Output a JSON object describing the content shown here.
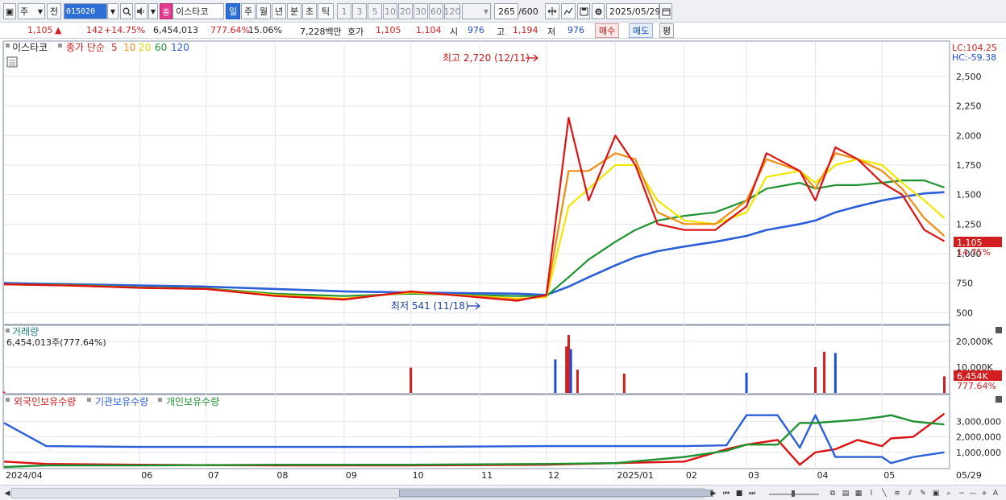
{
  "toolbar": {
    "market_label": "주",
    "prev_label": "전",
    "code": "015020",
    "name_badge": "종",
    "stock_name": "이스타코",
    "periods": [
      "일",
      "주",
      "월",
      "년",
      "분",
      "초",
      "틱"
    ],
    "selected_period": "일",
    "intervals": [
      "1",
      "3",
      "5",
      "10",
      "20",
      "30",
      "60",
      "120"
    ],
    "count_value": "265",
    "count_total": "/600",
    "date": "2025/05/29"
  },
  "quote": {
    "price": "1,105",
    "change": "142",
    "change_pct": "+14.75%",
    "volume": "6,454,013",
    "volume_ratio": "777.64%",
    "turnover": "15.06%",
    "amount": "7,228백만",
    "bidask_label": "호가",
    "ask": "1,105",
    "bid": "1,104",
    "open_label": "시",
    "open": "976",
    "high_label": "고",
    "high": "1,194",
    "low_label": "저",
    "low": "976",
    "buy_label": "매수",
    "sell_label": "매도",
    "eval_label": "평"
  },
  "price_panel": {
    "title": "이스타코",
    "ma_label": "종가 단순",
    "ma_periods": [
      "5",
      "10",
      "20",
      "60",
      "120"
    ],
    "lc_label": "LC:104.25",
    "hc_label": "HC:-59.38",
    "high_annotation": "최고 2,720 (12/11)",
    "low_annotation": "최저 541 (11/18)",
    "price_tag": "1,105",
    "pct_tag": "14.75%"
  },
  "volume_panel": {
    "title": "거래량",
    "subtitle": "6,454,013주(777.64%)",
    "volume_tag": "6,454K",
    "pct_tag": "777.64%"
  },
  "holding_panel": {
    "legend": [
      "외국인보유수량",
      "기관보유수량",
      "개인보유수량"
    ]
  },
  "colors": {
    "up": "#d21e1e",
    "down": "#1c4fd6",
    "ma5": "#dd1111",
    "ma10": "#f08c10",
    "ma20": "#f2e600",
    "ma60": "#1e9230",
    "ma120": "#2b5ed8",
    "foreign": "#dd1111",
    "institution": "#2b5ed8",
    "individual": "#1e9230"
  },
  "chart_data": [
    {
      "type": "line",
      "panel": "price",
      "title": "이스타코",
      "x_ticks": [
        "2024/04",
        "06",
        "07",
        "08",
        "09",
        "10",
        "11",
        "12",
        "2025/01",
        "02",
        "03",
        "04",
        "05",
        "05/29"
      ],
      "y_ticks": [
        500,
        750,
        1000,
        1250,
        1500,
        1750,
        2000,
        2250,
        2500
      ],
      "ylim": [
        420,
        2780
      ],
      "x": [
        "2024-04",
        "2024-05",
        "2024-06",
        "2024-07",
        "2024-08",
        "2024-09",
        "2024-10",
        "2024-11-18",
        "2024-12-01",
        "2024-12-11",
        "2024-12-20",
        "2025-01-01",
        "2025-01-10",
        "2025-01-20",
        "2025-02-01",
        "2025-02-15",
        "2025-03-01",
        "2025-03-10",
        "2025-03-25",
        "2025-04-01",
        "2025-04-10",
        "2025-04-20",
        "2025-05-01",
        "2025-05-10",
        "2025-05-20",
        "2025-05-29"
      ],
      "series": [
        {
          "name": "5",
          "values": [
            740,
            730,
            710,
            700,
            640,
            610,
            680,
            600,
            650,
            2150,
            1450,
            2000,
            1750,
            1250,
            1200,
            1200,
            1400,
            1850,
            1700,
            1450,
            1900,
            1800,
            1600,
            1500,
            1200,
            1105
          ]
        },
        {
          "name": "10",
          "values": [
            740,
            730,
            710,
            700,
            645,
            615,
            675,
            610,
            640,
            1700,
            1700,
            1850,
            1800,
            1350,
            1250,
            1250,
            1450,
            1800,
            1700,
            1550,
            1850,
            1800,
            1700,
            1550,
            1300,
            1150
          ]
        },
        {
          "name": "20",
          "values": [
            740,
            730,
            712,
            700,
            650,
            620,
            670,
            620,
            630,
            1400,
            1550,
            1750,
            1750,
            1450,
            1280,
            1250,
            1350,
            1650,
            1700,
            1600,
            1750,
            1800,
            1750,
            1600,
            1450,
            1300
          ]
        },
        {
          "name": "60",
          "values": [
            740,
            735,
            715,
            705,
            660,
            640,
            660,
            640,
            640,
            800,
            950,
            1100,
            1200,
            1280,
            1320,
            1350,
            1450,
            1550,
            1600,
            1550,
            1580,
            1580,
            1600,
            1620,
            1620,
            1560
          ]
        },
        {
          "name": "120",
          "values": [
            750,
            740,
            730,
            720,
            700,
            680,
            670,
            660,
            650,
            720,
            800,
            900,
            970,
            1020,
            1060,
            1100,
            1150,
            1200,
            1250,
            1280,
            1350,
            1400,
            1450,
            1480,
            1510,
            1520
          ]
        }
      ]
    },
    {
      "type": "bar",
      "panel": "volume",
      "title": "거래량",
      "y_ticks": [
        "10,000K",
        "20,000K"
      ],
      "ylim": [
        0,
        25000
      ],
      "x": [
        "2024-04",
        "2024-10",
        "2024-12-05",
        "2024-12-10",
        "2024-12-11",
        "2024-12-12",
        "2024-12-15",
        "2025-01-05",
        "2025-03-01",
        "2025-04-01",
        "2025-04-05",
        "2025-04-10",
        "2025-05-29"
      ],
      "values": [
        500,
        9800,
        13000,
        18000,
        22500,
        17000,
        9000,
        7500,
        7800,
        10000,
        16000,
        15500,
        6454
      ]
    },
    {
      "type": "line",
      "panel": "holdings",
      "y_ticks": [
        "1,000,000",
        "2,000,000",
        "3,000,000"
      ],
      "ylim": [
        0,
        3800000
      ],
      "x": [
        "2024-04",
        "2024-04-20",
        "2024-06",
        "2024-08",
        "2024-10",
        "2024-12",
        "2025-01",
        "2025-02",
        "2025-02-20",
        "2025-03-01",
        "2025-03-15",
        "2025-03-25",
        "2025-04-01",
        "2025-04-10",
        "2025-04-20",
        "2025-05-01",
        "2025-05-05",
        "2025-05-15",
        "2025-05-29"
      ],
      "series": [
        {
          "name": "외국인보유수량",
          "values": [
            400000,
            250000,
            200000,
            150000,
            150000,
            200000,
            300000,
            400000,
            1200000,
            1500000,
            1800000,
            200000,
            1000000,
            1200000,
            1800000,
            1400000,
            1900000,
            2000000,
            3500000
          ]
        },
        {
          "name": "기관보유수량",
          "values": [
            2900000,
            1400000,
            1350000,
            1350000,
            1350000,
            1400000,
            1400000,
            1400000,
            1450000,
            3400000,
            3400000,
            1300000,
            3400000,
            700000,
            700000,
            700000,
            300000,
            700000,
            1000000
          ]
        },
        {
          "name": "개인보유수량",
          "values": [
            50000,
            150000,
            150000,
            200000,
            200000,
            250000,
            300000,
            700000,
            1100000,
            1500000,
            1500000,
            2900000,
            2900000,
            3000000,
            3100000,
            3300000,
            3400000,
            3000000,
            2800000
          ]
        }
      ]
    }
  ]
}
